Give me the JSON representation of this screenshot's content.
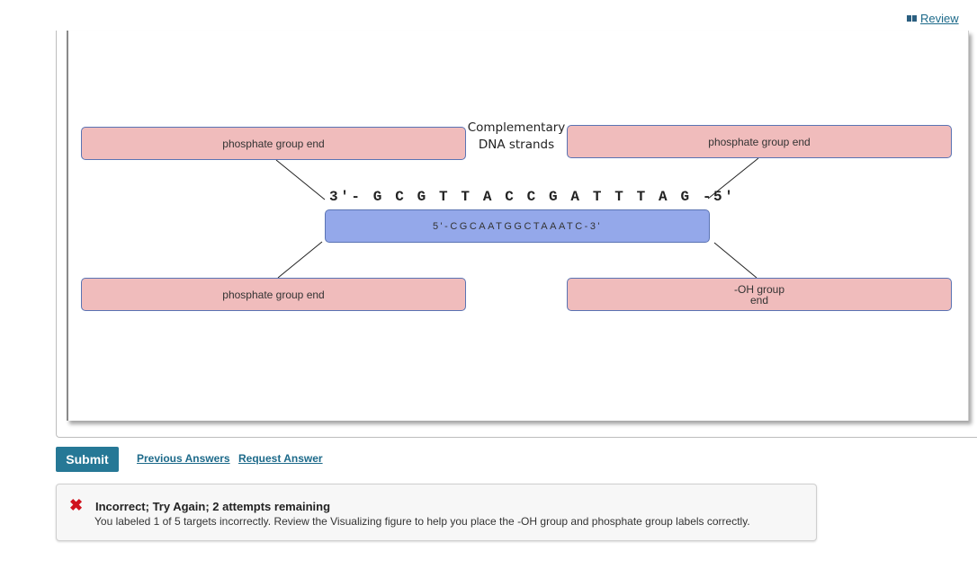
{
  "header": {
    "review_label": " Review",
    "review_icon": "book-icon"
  },
  "diagram": {
    "caption_line1": "Complementary",
    "caption_line2": "DNA strands",
    "top_strand": "3'- G C G T T A C C G A T T T A G -5'",
    "bottom_strand": "5'-CGCAATGGCTAAATC-3'",
    "labels": {
      "top_left": "phosphate group end",
      "top_right": "phosphate group end",
      "bottom_left": "phosphate group end",
      "bottom_right_line1": "-OH group",
      "bottom_right_line2": "end"
    }
  },
  "actions": {
    "submit_label": "Submit",
    "previous_answers_label": "Previous Answers",
    "request_answer_label": "Request Answer"
  },
  "feedback": {
    "icon": "x-icon",
    "icon_color": "#d0121d",
    "title": "Incorrect; Try Again; 2 attempts remaining",
    "message": "You labeled 1 of 5 targets incorrectly. Review the Visualizing figure to help you place the -OH group and phosphate group labels correctly."
  },
  "colors": {
    "label_fill": "#f0bcbc",
    "strand_fill": "#94a8ea",
    "accent": "#267896",
    "link": "#1d6a8a"
  }
}
